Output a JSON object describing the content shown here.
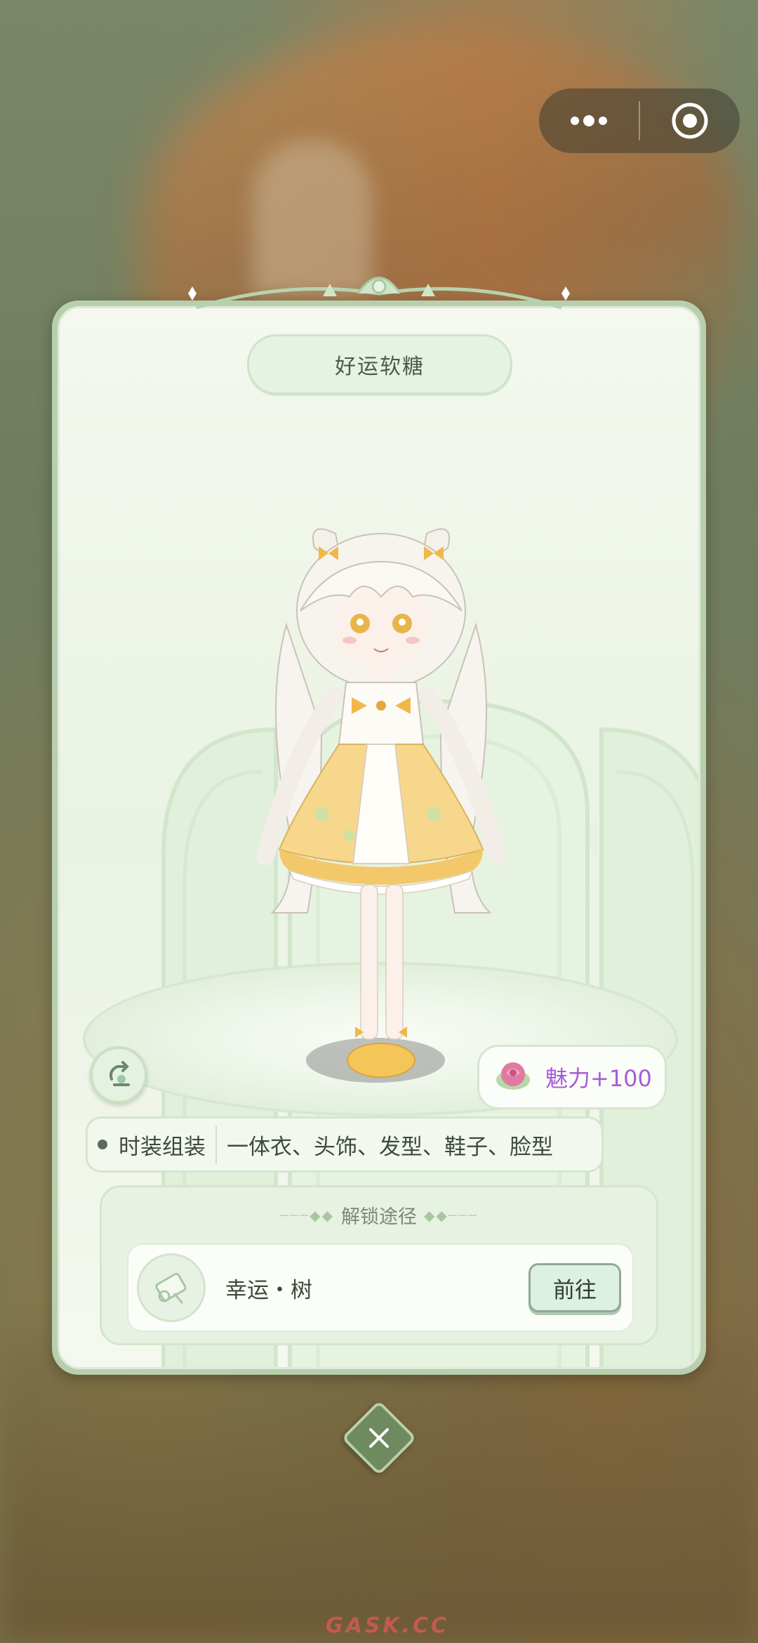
{
  "capsule": {
    "more_icon": "more-dots-icon",
    "target_icon": "target-circle-icon"
  },
  "card": {
    "title": "好运软糖",
    "charm": {
      "icon": "rose-icon",
      "label": "魅力+100",
      "color": "#a85bd8"
    },
    "suit": {
      "heading": "时装组装",
      "parts": "一体衣、头饰、发型、鞋子、脸型"
    },
    "unlock": {
      "title": "解锁途径",
      "route": {
        "icon": "scroll-icon",
        "name": "幸运・树",
        "button": "前往"
      }
    },
    "side_button_icon": "hanger-rotate-icon"
  },
  "close_icon": "close-x-icon",
  "watermark": "GASK.CC",
  "colors": {
    "accent_green": "#cfe3ca",
    "button_border": "#8faa92",
    "frame": "#b8cfae"
  }
}
